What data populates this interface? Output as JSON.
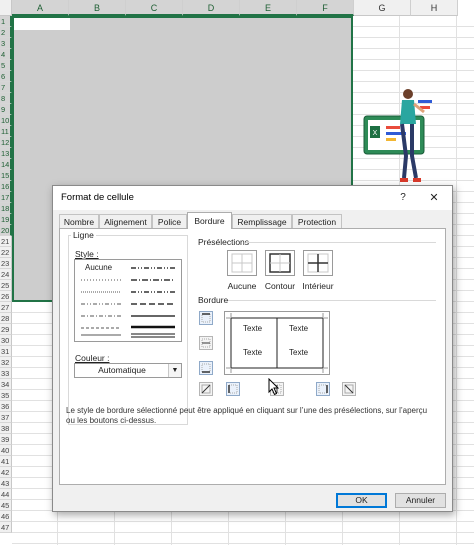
{
  "sheet": {
    "columns": [
      "A",
      "B",
      "C",
      "D",
      "E",
      "F",
      "G",
      "H"
    ],
    "rows": [
      "1",
      "2",
      "3",
      "4",
      "5",
      "6",
      "7",
      "8",
      "9",
      "10",
      "11",
      "12",
      "13",
      "14",
      "15",
      "16",
      "17",
      "18",
      "19",
      "20",
      "21",
      "22",
      "23",
      "24",
      "25",
      "26",
      "27",
      "28",
      "29",
      "30",
      "31",
      "32",
      "33",
      "34",
      "35",
      "36",
      "37",
      "38",
      "39",
      "40",
      "41",
      "42",
      "43",
      "44",
      "45",
      "46",
      "47"
    ],
    "selected_range": "A1:F20",
    "accent_color": "#217346",
    "selection_fill": "#cdcdcd"
  },
  "dialog": {
    "title": "Format de cellule",
    "help_label": "?",
    "close_label": "✕",
    "tabs": [
      {
        "label": "Nombre"
      },
      {
        "label": "Alignement"
      },
      {
        "label": "Police"
      },
      {
        "label": "Bordure",
        "active": true
      },
      {
        "label": "Remplissage"
      },
      {
        "label": "Protection"
      }
    ],
    "line_group": {
      "title": "Ligne",
      "style_label": "Style :",
      "none_label": "Aucune",
      "color_label": "Couleur :",
      "color_value": "Automatique"
    },
    "presets": {
      "title": "Présélections",
      "items": [
        {
          "label": "Aucune",
          "icon": "preset-none-icon"
        },
        {
          "label": "Contour",
          "icon": "preset-outline-icon"
        },
        {
          "label": "Intérieur",
          "icon": "preset-inside-icon"
        }
      ]
    },
    "border": {
      "title": "Bordure",
      "preview_texts": [
        "Texte",
        "Texte",
        "Texte",
        "Texte"
      ]
    },
    "hint": "Le style de bordure sélectionné peut être appliqué en cliquant sur l’une des présélections, sur l’aperçu ou les boutons ci-dessus.",
    "ok_label": "OK",
    "cancel_label": "Annuler"
  }
}
